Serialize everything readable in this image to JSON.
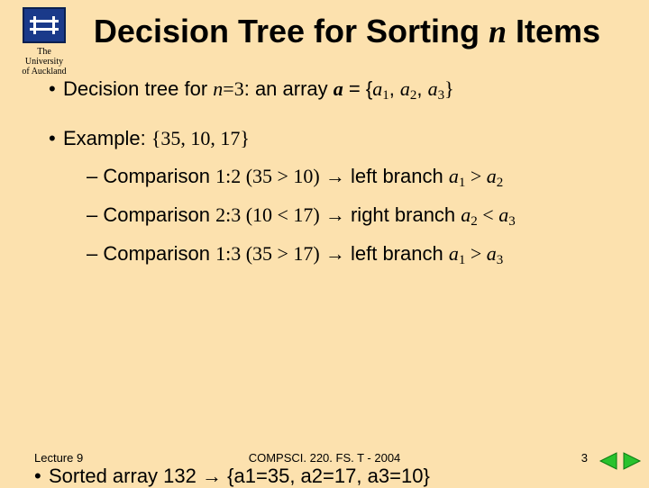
{
  "logo": {
    "line1": "The",
    "line2": "University",
    "line3": "of Auckland"
  },
  "title": {
    "pre": "Decision Tree for Sorting ",
    "var": "n",
    "post": " Items"
  },
  "b1": {
    "lead": "Decision tree for ",
    "nvar": "n",
    "eq": "=3",
    "mid": ": an array ",
    "arr": "a",
    "rest": " = {",
    "a1": "a",
    "s1": "1",
    "c1": ", ",
    "a2": "a",
    "s2": "2",
    "c2": ", ",
    "a3": "a",
    "s3": "3",
    "close": "}"
  },
  "b2": {
    "lead": "Example: ",
    "set": "{35, 10, 17}"
  },
  "cmp1": {
    "t1": "Comparison ",
    "r": "1:2  (35 > 10)",
    "arrow": " → ",
    "t2": "left branch   ",
    "av": "a",
    "as": "1",
    "op": " > ",
    "bv": "a",
    "bs": "2"
  },
  "cmp2": {
    "t1": "Comparison ",
    "r": "2:3  (10 < 17)",
    "arrow": " → ",
    "t2": "right branch ",
    "av": "a",
    "as": "2",
    "op": " < ",
    "bv": "a",
    "bs": "3"
  },
  "cmp3": {
    "t1": "Comparison ",
    "r": "1:3  (35 > 17)",
    "arrow": " → ",
    "t2": "left branch   ",
    "av": "a",
    "as": "1",
    "op": " > ",
    "bv": "a",
    "bs": "3"
  },
  "sorted": {
    "lead": "Sorted array ",
    "n": "132",
    "arrow": " → ",
    "open": "{",
    "a1v": "a",
    "a1s": "1",
    "e1": "=35",
    "c1": ", ",
    "a2v": "a",
    "a2s": "2",
    "e2": "=17",
    "c2": ", ",
    "a3v": "a",
    "a3s": "3",
    "e3": "=10",
    "close": "}"
  },
  "footer": {
    "left": "Lecture 9",
    "center": "COMPSCI. 220. FS. T - 2004",
    "right": "3"
  }
}
